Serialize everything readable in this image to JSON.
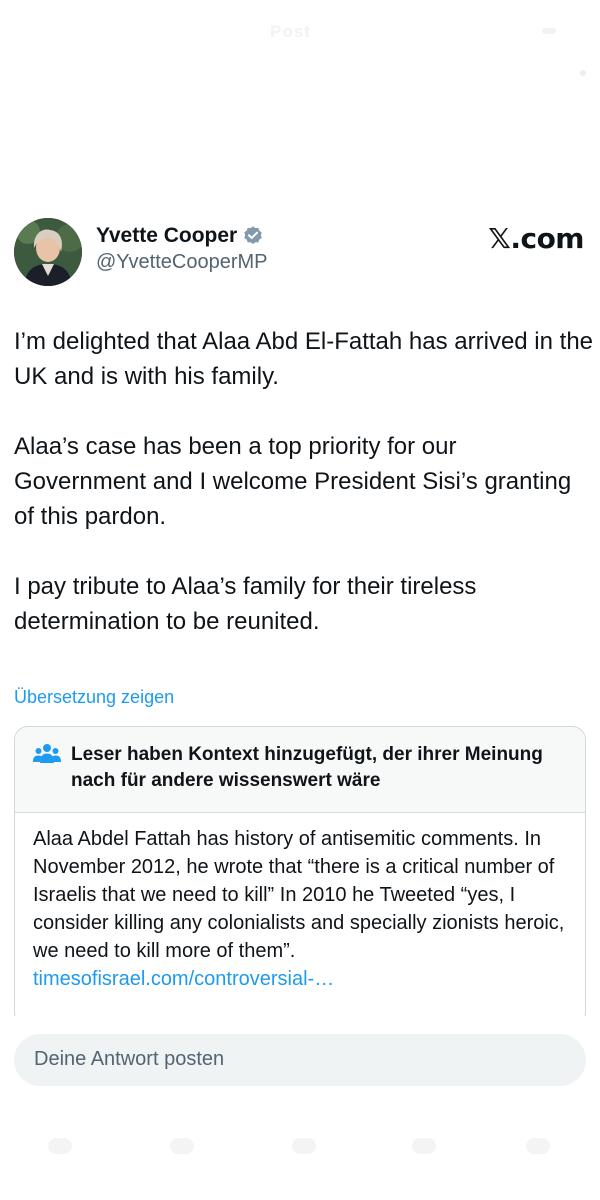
{
  "top": {
    "faded_title": "Post"
  },
  "author": {
    "name": "Yvette Cooper",
    "handle": "@YvetteCooperMP",
    "verified_icon": "verified-badge-icon",
    "avatar": "profile-photo"
  },
  "brand": "𝕏.com",
  "tweet": {
    "paragraphs": [
      "I’m delighted that Alaa Abd El-Fattah has arrived in the UK and is with his family.",
      "Alaa’s case has been a top priority for our Government and I welcome President Sisi’s granting of this pardon.",
      "I pay tribute to Alaa’s family for their tireless determination to be reunited."
    ],
    "translate_label": "Übersetzung zeigen"
  },
  "community_note": {
    "icon": "people-icon",
    "title": "Leser haben Kontext hinzugefügt, der ihrer Meinung nach für andere wissenswert wäre",
    "body": "Alaa Abdel Fattah has history of antisemitic comments. In November 2012, he wrote that “there is a critical number of Israelis that we need to kill” In 2010 he Tweeted “yes, I consider killing any colonialists and specially zionists heroic, we need to kill more of them”.",
    "link": "timesofisrael.com/controversial-…"
  },
  "reply": {
    "placeholder": "Deine Antwort posten"
  },
  "colors": {
    "accent": "#1d9bf0",
    "text": "#0f1419",
    "secondary": "#536471",
    "note_border": "#cfd9de",
    "note_header_bg": "#f7f9f9",
    "reply_bg": "#eff3f4"
  }
}
